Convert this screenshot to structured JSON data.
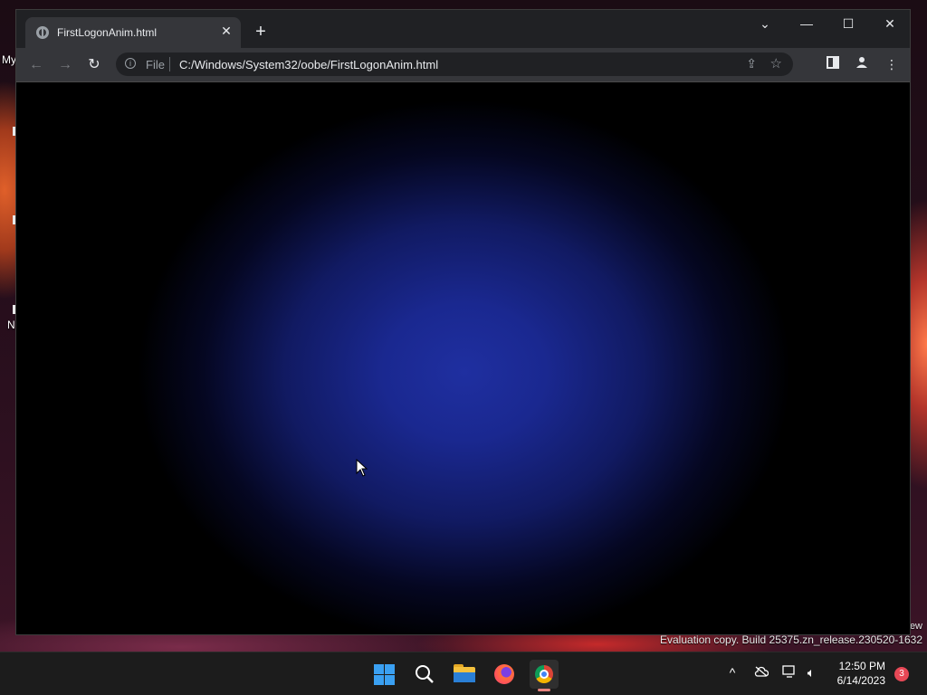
{
  "desktop": {
    "labels": [
      "My",
      "N"
    ],
    "watermark_partial": "ew",
    "watermark": "Evaluation copy. Build 25375.zn_release.230520-1632"
  },
  "browser": {
    "tab": {
      "title": "FirstLogonAnim.html",
      "close": "✕"
    },
    "new_tab": "+",
    "window_controls": {
      "tab_search": "⌄",
      "minimize": "—",
      "maximize": "☐",
      "close": "✕"
    },
    "nav": {
      "back": "←",
      "forward": "→",
      "reload": "↻"
    },
    "omnibox": {
      "scheme": "File",
      "url": "C:/Windows/System32/oobe/FirstLogonAnim.html"
    },
    "content": {
      "glow_color": "#1f2fa0",
      "background": "#000000"
    }
  },
  "taskbar": {
    "apps": [
      "start-icon",
      "search-icon",
      "file-explorer-icon",
      "firefox-icon",
      "chrome-icon"
    ],
    "tray": {
      "overflow": "^"
    },
    "clock": {
      "time": "12:50 PM",
      "date": "6/14/2023"
    },
    "notifications": "3"
  }
}
